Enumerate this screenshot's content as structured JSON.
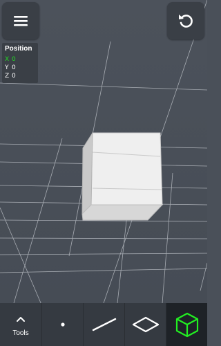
{
  "header": {
    "menu_icon": "hamburger-menu-icon",
    "reset_icon": "rotate-left-icon"
  },
  "position_panel": {
    "title": "Position",
    "rows": [
      {
        "axis": "X",
        "value": "0",
        "color": "#22dd22"
      },
      {
        "axis": "Y",
        "value": "0",
        "color": "#ffffff"
      },
      {
        "axis": "Z",
        "value": "0",
        "color": "#ffffff"
      }
    ]
  },
  "toolbar": {
    "tools_label": "Tools",
    "items": [
      {
        "icon": "chevron-up-icon"
      },
      {
        "icon": "point-icon"
      },
      {
        "icon": "line-icon"
      },
      {
        "icon": "plane-icon"
      },
      {
        "icon": "cube-icon",
        "active": true,
        "accent": "#22ee22"
      }
    ]
  },
  "colors": {
    "background": "#4a5059",
    "panel": "#3a3f46",
    "toolbar": "#353a41",
    "accent": "#22ee22"
  }
}
